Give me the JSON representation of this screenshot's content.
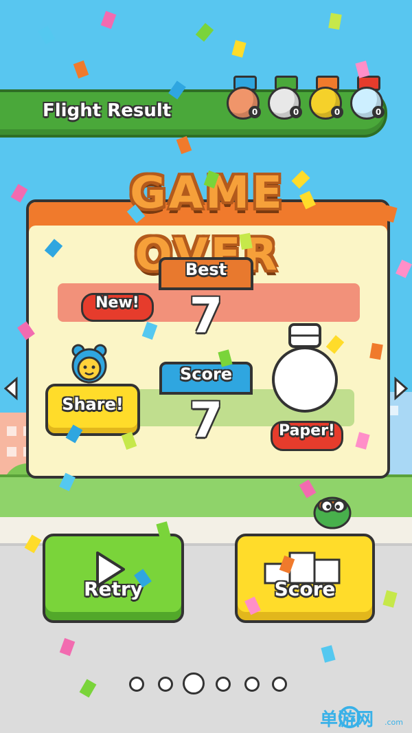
{
  "header": {
    "title": "Flight Result"
  },
  "medals": [
    {
      "name": "bronze-medal",
      "color": "#f0956a",
      "count": "0"
    },
    {
      "name": "silver-medal",
      "color": "#e8e8e8",
      "count": "0"
    },
    {
      "name": "gold-medal",
      "color": "#f5d12a",
      "count": "0"
    },
    {
      "name": "platinum-medal",
      "color": "#cdefff",
      "count": "0"
    }
  ],
  "result": {
    "title": "GAME OVER",
    "best_label": "Best",
    "new_badge": "New!",
    "best_value": "7",
    "score_label": "Score",
    "score_value": "7",
    "share_label": "Share!",
    "paper_label": "Paper!"
  },
  "buttons": {
    "retry_label": "Retry",
    "score_label": "Score"
  },
  "pagination": {
    "total": 6,
    "active_index": 2
  },
  "watermark": {
    "text": "单游网",
    "suffix": ".com"
  },
  "colors": {
    "sky": "#58c6f0",
    "banner_green": "#4aa83a",
    "title_orange": "#f6a03a",
    "panel_cream": "#fbf5c6",
    "retry_green": "#7ad43a",
    "score_yellow": "#ffdc2a",
    "badge_red": "#e63c2c"
  },
  "icons": [
    "arrow-left-icon",
    "arrow-right-icon",
    "play-icon",
    "podium-icon",
    "mascot-icon",
    "paper-medal-icon"
  ]
}
